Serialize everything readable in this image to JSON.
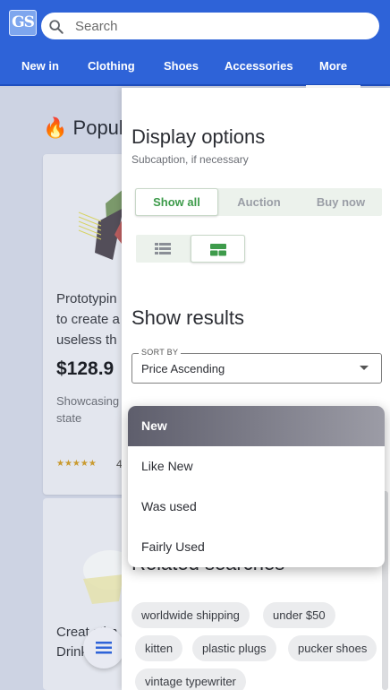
{
  "header": {
    "logo_text": "GS",
    "search_placeholder": "Search",
    "nav": [
      {
        "label": "New in"
      },
      {
        "label": "Clothing"
      },
      {
        "label": "Shoes"
      },
      {
        "label": "Accessories"
      },
      {
        "label": "More",
        "active": true
      }
    ],
    "colors": {
      "bar": "#2e63d8",
      "accent": "#3e9b4b"
    }
  },
  "background": {
    "section_title": "Popul",
    "section_icon": "fire-icon",
    "card1": {
      "title": "Prototypin to create a useless th",
      "price": "$128.9",
      "description": "Showcasing state",
      "stars": "★★★★★",
      "rating": "4"
    },
    "card2": {
      "title": "Creat stim Drink ever"
    }
  },
  "drawer": {
    "title": "Display options",
    "subcaption": "Subcaption, if necessary",
    "filter_tabs": [
      {
        "label": "Show all",
        "active": true
      },
      {
        "label": "Auction",
        "active": false
      },
      {
        "label": "Buy now",
        "active": false
      }
    ],
    "view_modes": [
      {
        "icon": "list-view-icon",
        "active": false
      },
      {
        "icon": "card-view-icon",
        "active": true
      }
    ],
    "results_title": "Show results",
    "sort": {
      "legend": "SORT BY",
      "value": "Price Ascending"
    },
    "condition_menu": [
      {
        "label": "New",
        "selected": true
      },
      {
        "label": "Like New"
      },
      {
        "label": "Was used"
      },
      {
        "label": "Fairly Used"
      }
    ],
    "related_title": "Related searches",
    "related_chips": [
      "worldwide shipping",
      "under $50",
      "kitten",
      "plastic plugs",
      "pucker shoes",
      "vintage typewriter"
    ]
  }
}
